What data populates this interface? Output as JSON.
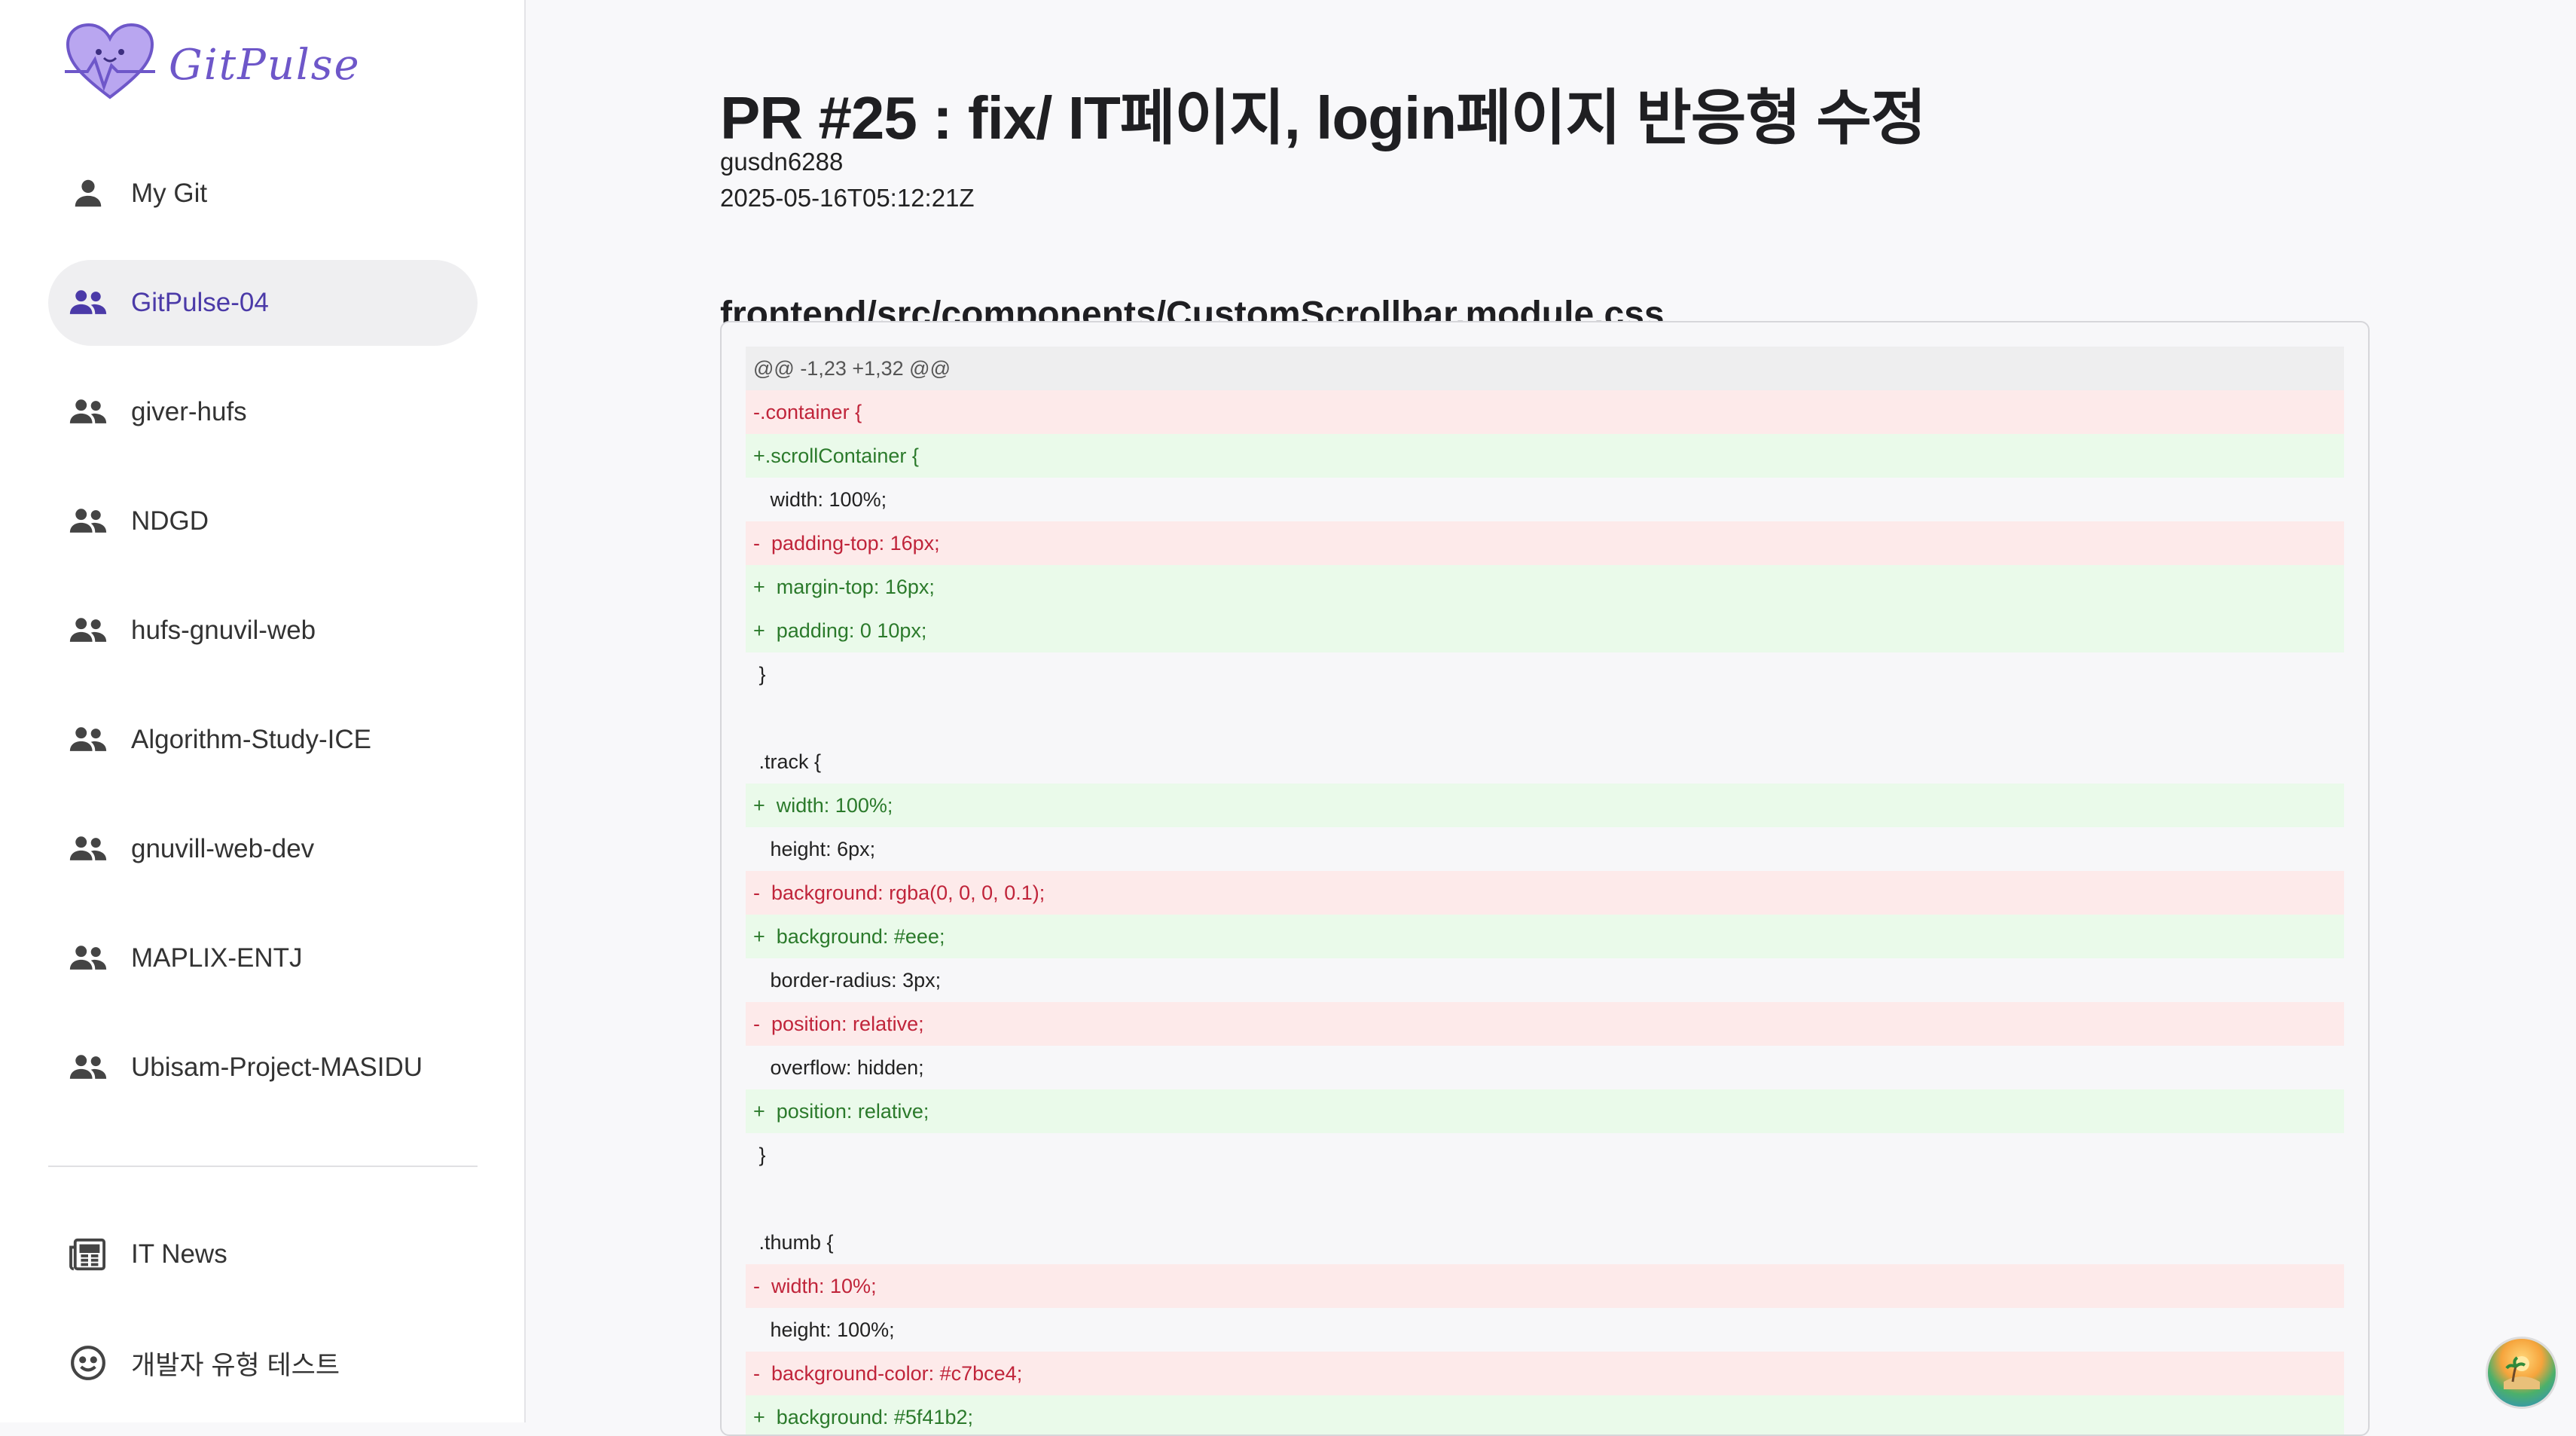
{
  "app": {
    "name": "GitPulse"
  },
  "sidebar": {
    "items": [
      {
        "label": "My Git",
        "icon": "person-icon",
        "active": false
      },
      {
        "label": "GitPulse-04",
        "icon": "group-icon",
        "active": true
      },
      {
        "label": "giver-hufs",
        "icon": "group-icon",
        "active": false
      },
      {
        "label": "NDGD",
        "icon": "group-icon",
        "active": false
      },
      {
        "label": "hufs-gnuvil-web",
        "icon": "group-icon",
        "active": false
      },
      {
        "label": "Algorithm-Study-ICE",
        "icon": "group-icon",
        "active": false
      },
      {
        "label": "gnuvill-web-dev",
        "icon": "group-icon",
        "active": false
      },
      {
        "label": "MAPLIX-ENTJ",
        "icon": "group-icon",
        "active": false
      },
      {
        "label": "Ubisam-Project-MASIDU",
        "icon": "group-icon",
        "active": false
      }
    ],
    "bottom_items": [
      {
        "label": "IT News",
        "icon": "newspaper-icon"
      },
      {
        "label": "개발자 유형 테스트",
        "icon": "smiley-icon"
      }
    ]
  },
  "pr": {
    "title": "PR #25 : fix/ IT페이지, login페이지 반응형 수정",
    "author": "gusdn6288",
    "date": "2025-05-16T05:12:21Z"
  },
  "file": {
    "path": "frontend/src/components/CustomScrollbar.module.css",
    "lines": [
      {
        "type": "hunk",
        "text": "@@ -1,23 +1,32 @@"
      },
      {
        "type": "del",
        "text": "-.container {"
      },
      {
        "type": "add",
        "text": "+.scrollContainer {"
      },
      {
        "type": "ctx",
        "text": "   width: 100%;"
      },
      {
        "type": "del",
        "text": "-  padding-top: 16px;"
      },
      {
        "type": "add",
        "text": "+  margin-top: 16px;"
      },
      {
        "type": "add",
        "text": "+  padding: 0 10px;"
      },
      {
        "type": "ctx",
        "text": " }"
      },
      {
        "type": "ctx",
        "text": ""
      },
      {
        "type": "ctx",
        "text": " .track {"
      },
      {
        "type": "add",
        "text": "+  width: 100%;"
      },
      {
        "type": "ctx",
        "text": "   height: 6px;"
      },
      {
        "type": "del",
        "text": "-  background: rgba(0, 0, 0, 0.1);"
      },
      {
        "type": "add",
        "text": "+  background: #eee;"
      },
      {
        "type": "ctx",
        "text": "   border-radius: 3px;"
      },
      {
        "type": "del",
        "text": "-  position: relative;"
      },
      {
        "type": "ctx",
        "text": "   overflow: hidden;"
      },
      {
        "type": "add",
        "text": "+  position: relative;"
      },
      {
        "type": "ctx",
        "text": " }"
      },
      {
        "type": "ctx",
        "text": ""
      },
      {
        "type": "ctx",
        "text": " .thumb {"
      },
      {
        "type": "del",
        "text": "-  width: 10%;"
      },
      {
        "type": "ctx",
        "text": "   height: 100%;"
      },
      {
        "type": "del",
        "text": "-  background-color: #c7bce4;"
      },
      {
        "type": "add",
        "text": "+  background: #5f41b2;"
      }
    ]
  },
  "colors": {
    "accent": "#4b3aa8",
    "logo": "#6e57c9",
    "add_bg": "#eafaea",
    "del_bg": "#fdeaea",
    "add_text": "#2b7a2b",
    "del_text": "#c0243a"
  },
  "fab": {
    "icon": "beach-avatar-icon"
  }
}
